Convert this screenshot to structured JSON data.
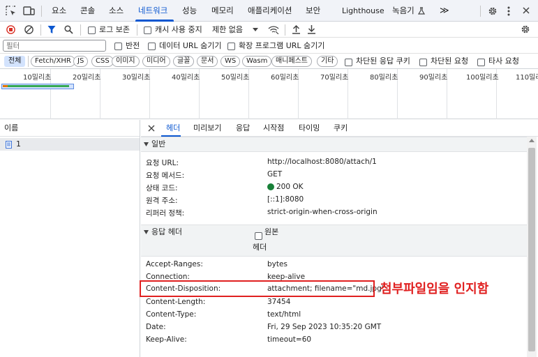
{
  "tabs": [
    "요소",
    "콘솔",
    "소스",
    "네트워크",
    "성능",
    "메모리",
    "애플리케이션",
    "보안",
    "Lighthouse",
    "녹음기"
  ],
  "tabs_more": "≫",
  "toolbar": {
    "preserve_log": "로그 보존",
    "disable_cache": "캐시 사용 중지",
    "throttle": "제한 없음"
  },
  "filter": {
    "placeholder": "필터",
    "invert": "반전",
    "hide_data_urls": "데이터 URL 숨기기",
    "hide_ext_urls": "확장 프로그램 URL 숨기기"
  },
  "type_filters": [
    "전체",
    "Fetch/XHR",
    "JS",
    "CSS",
    "이미지",
    "미디어",
    "글꼴",
    "문서",
    "WS",
    "Wasm",
    "매니페스트",
    "기타"
  ],
  "type_checks": {
    "blocked_cookies": "차단된 응답 쿠키",
    "blocked_requests": "차단된 요청",
    "third_party": "타사 요청"
  },
  "timeline_ticks": [
    "10밀리초",
    "20밀리초",
    "30밀리초",
    "40밀리초",
    "50밀리초",
    "60밀리초",
    "70밀리초",
    "80밀리초",
    "90밀리초",
    "100밀리초",
    "110밀리초"
  ],
  "request_list": {
    "header": "이름",
    "items": [
      {
        "name": "1"
      }
    ]
  },
  "detail_tabs": [
    "헤더",
    "미리보기",
    "응답",
    "시작점",
    "타이밍",
    "쿠키"
  ],
  "general": {
    "title": "일반",
    "rows": [
      {
        "key": "요청 URL:",
        "value": "http://localhost:8080/attach/1"
      },
      {
        "key": "요청 메서드:",
        "value": "GET"
      },
      {
        "key": "상태 코드:",
        "value": "200 OK"
      },
      {
        "key": "원격 주소:",
        "value": "[::1]:8080"
      },
      {
        "key": "리퍼러 정책:",
        "value": "strict-origin-when-cross-origin"
      }
    ]
  },
  "response_headers": {
    "title": "응답 헤더",
    "raw_label": "원본",
    "sub_label": "헤더",
    "rows": [
      {
        "key": "Accept-Ranges:",
        "value": "bytes"
      },
      {
        "key": "Connection:",
        "value": "keep-alive"
      },
      {
        "key": "Content-Disposition:",
        "value": "attachment; filename=\"md.jpg\""
      },
      {
        "key": "Content-Length:",
        "value": "37454"
      },
      {
        "key": "Content-Type:",
        "value": "text/html"
      },
      {
        "key": "Date:",
        "value": "Fri, 29 Sep 2023 10:35:20 GMT"
      },
      {
        "key": "Keep-Alive:",
        "value": "timeout=60"
      }
    ]
  },
  "annotation": "첨부파일임을 인지함",
  "colors": {
    "accent": "#0b57d0",
    "record_red": "#d93025",
    "status_green": "#188038",
    "annotation_red": "#e02020"
  }
}
